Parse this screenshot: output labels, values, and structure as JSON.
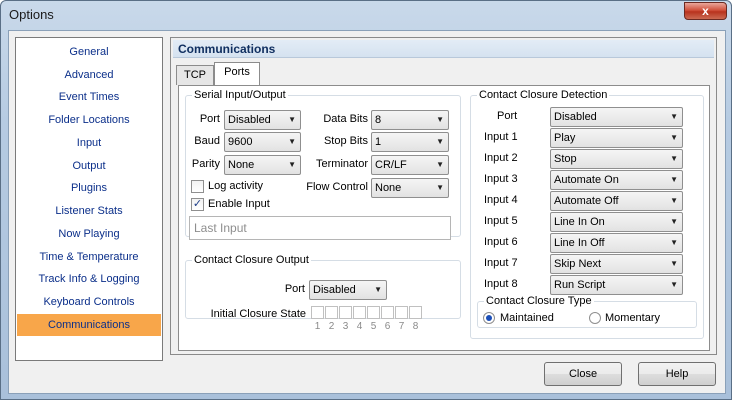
{
  "window": {
    "title": "Options",
    "close_glyph": "x"
  },
  "nav": {
    "items": [
      "General",
      "Advanced",
      "Event Times",
      "Folder Locations",
      "Input",
      "Output",
      "Plugins",
      "Listener Stats",
      "Now Playing",
      "Time & Temperature",
      "Track Info & Logging",
      "Keyboard Controls",
      "Communications"
    ],
    "selected": "Communications",
    "selected_color": "#f8a64a"
  },
  "panel": {
    "title": "Communications"
  },
  "tabs": [
    {
      "label": "TCP"
    },
    {
      "label": "Ports",
      "active": true
    }
  ],
  "serial": {
    "legend": "Serial Input/Output",
    "port_label": "Port",
    "port_value": "Disabled",
    "baud_label": "Baud",
    "baud_value": "9600",
    "parity_label": "Parity",
    "parity_value": "None",
    "data_bits_label": "Data Bits",
    "data_bits_value": "8",
    "stop_bits_label": "Stop Bits",
    "stop_bits_value": "1",
    "terminator_label": "Terminator",
    "terminator_value": "CR/LF",
    "flow_control_label": "Flow Control",
    "flow_control_value": "None",
    "log_activity_label": "Log activity",
    "log_activity_checked": false,
    "enable_input_label": "Enable Input",
    "enable_input_checked": true,
    "last_input_placeholder": "Last Input"
  },
  "closure_output": {
    "legend": "Contact Closure Output",
    "port_label": "Port",
    "port_value": "Disabled",
    "initial_state_label": "Initial Closure State",
    "digits": [
      "1",
      "2",
      "3",
      "4",
      "5",
      "6",
      "7",
      "8"
    ]
  },
  "closure_detection": {
    "legend": "Contact Closure Detection",
    "port_label": "Port",
    "port_value": "Disabled",
    "inputs": [
      {
        "label": "Input 1",
        "value": "Play"
      },
      {
        "label": "Input 2",
        "value": "Stop"
      },
      {
        "label": "Input 3",
        "value": "Automate On"
      },
      {
        "label": "Input 4",
        "value": "Automate Off"
      },
      {
        "label": "Input 5",
        "value": "Line In On"
      },
      {
        "label": "Input 6",
        "value": "Line In Off"
      },
      {
        "label": "Input 7",
        "value": "Skip Next"
      },
      {
        "label": "Input 8",
        "value": "Run Script"
      }
    ],
    "type_legend": "Contact Closure Type",
    "maintained_label": "Maintained",
    "momentary_label": "Momentary",
    "selected_type": "Maintained"
  },
  "buttons": {
    "close": "Close",
    "help": "Help"
  },
  "icons": {
    "dropdown": "chevron-down-icon",
    "check": "checkmark-icon"
  }
}
